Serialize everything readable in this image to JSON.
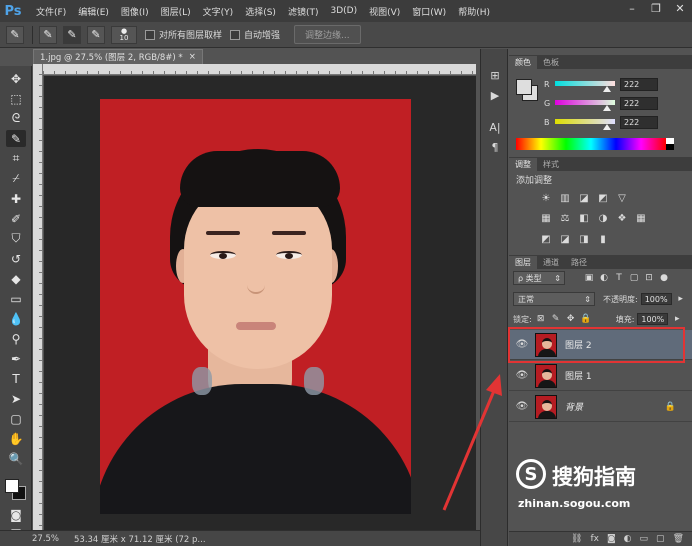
{
  "app": {
    "logo": "Ps"
  },
  "menu": [
    "文件(F)",
    "编辑(E)",
    "图像(I)",
    "图层(L)",
    "文字(Y)",
    "选择(S)",
    "滤镜(T)",
    "3D(D)",
    "视图(V)",
    "窗口(W)",
    "帮助(H)"
  ],
  "window_controls": {
    "minimize": "–",
    "restore": "❐",
    "close": "✕"
  },
  "options": {
    "brush_size": "10",
    "sample_all_label": "对所有图层取样",
    "auto_enhance_label": "自动增强",
    "refine_edge_label": "调整边缘..."
  },
  "document": {
    "tab_title": "1.jpg @ 27.5% (图层 2, RGB/8#) *",
    "close_glyph": "×"
  },
  "status": {
    "zoom": "27.5%",
    "info": "53.34 厘米 x 71.12 厘米 (72 p..."
  },
  "color_panel": {
    "tabs": [
      "颜色",
      "色板"
    ],
    "channels": [
      {
        "label": "R",
        "value": "222",
        "level": 0.87,
        "gradient": "linear-gradient(90deg,#00dede,#ffdede)"
      },
      {
        "label": "G",
        "value": "222",
        "level": 0.87,
        "gradient": "linear-gradient(90deg,#de00de,#deffde)"
      },
      {
        "label": "B",
        "value": "222",
        "level": 0.87,
        "gradient": "linear-gradient(90deg,#dede00,#dedeff)"
      }
    ]
  },
  "adjust_panel": {
    "tabs": [
      "调整",
      "样式"
    ],
    "title": "添加调整",
    "rows": [
      [
        "☀",
        "▥",
        "◪",
        "◩",
        "▽"
      ],
      [
        "▦",
        "⚖",
        "◧",
        "◑",
        "❖",
        "▦"
      ],
      [
        "◩",
        "◪",
        "◨",
        "▮"
      ]
    ]
  },
  "layers_panel": {
    "tabs": [
      "图层",
      "通道",
      "路径"
    ],
    "filter_label": "ρ 类型",
    "blend_mode": "正常",
    "opacity_label": "不透明度:",
    "opacity_value": "100%",
    "lock_label": "锁定:",
    "fill_label": "填充:",
    "fill_value": "100%",
    "layers": [
      {
        "name": "图层 2",
        "selected": true,
        "italic": false,
        "locked": false
      },
      {
        "name": "图层 1",
        "selected": false,
        "italic": false,
        "locked": false
      },
      {
        "name": "背景",
        "selected": false,
        "italic": true,
        "locked": true
      }
    ]
  },
  "watermark": {
    "logo": "S",
    "text": "搜狗指南",
    "url": "zhinan.sogou.com"
  },
  "colors": {
    "highlight": "#e23434",
    "photo_bg": "#c01f24"
  }
}
